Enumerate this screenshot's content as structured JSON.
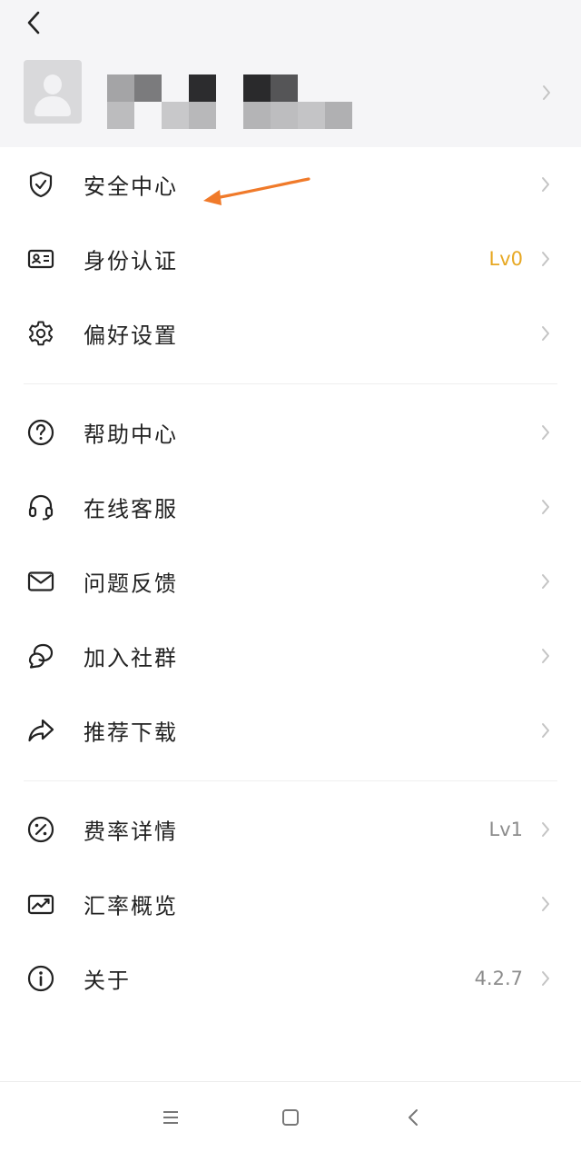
{
  "colors": {
    "accent_gold": "#e7a823",
    "annotation_arrow": "#f07a2a",
    "header_bg": "#f5f5f7"
  },
  "header": {
    "back_icon": "back-chevron-icon",
    "profile": {
      "avatar_icon": "default-avatar-icon",
      "name_obscured": true
    }
  },
  "menu": {
    "group1": [
      {
        "icon": "shield-check-icon",
        "label": "安全中心",
        "value": ""
      },
      {
        "icon": "id-card-icon",
        "label": "身份认证",
        "value": "Lv0"
      },
      {
        "icon": "gear-icon",
        "label": "偏好设置",
        "value": ""
      }
    ],
    "group2": [
      {
        "icon": "help-circle-icon",
        "label": "帮助中心",
        "value": ""
      },
      {
        "icon": "headset-icon",
        "label": "在线客服",
        "value": ""
      },
      {
        "icon": "mail-icon",
        "label": "问题反馈",
        "value": ""
      },
      {
        "icon": "chat-bubbles-icon",
        "label": "加入社群",
        "value": ""
      },
      {
        "icon": "share-arrow-icon",
        "label": "推荐下载",
        "value": ""
      }
    ],
    "group3": [
      {
        "icon": "percent-circle-icon",
        "label": "费率详情",
        "value": "Lv1"
      },
      {
        "icon": "chart-card-icon",
        "label": "汇率概览",
        "value": ""
      },
      {
        "icon": "info-circle-icon",
        "label": "关于",
        "value": "4.2.7"
      }
    ]
  },
  "system_nav": {
    "menu_icon": "menu-lines-icon",
    "home_icon": "home-square-icon",
    "back_icon": "back-triangle-icon"
  }
}
